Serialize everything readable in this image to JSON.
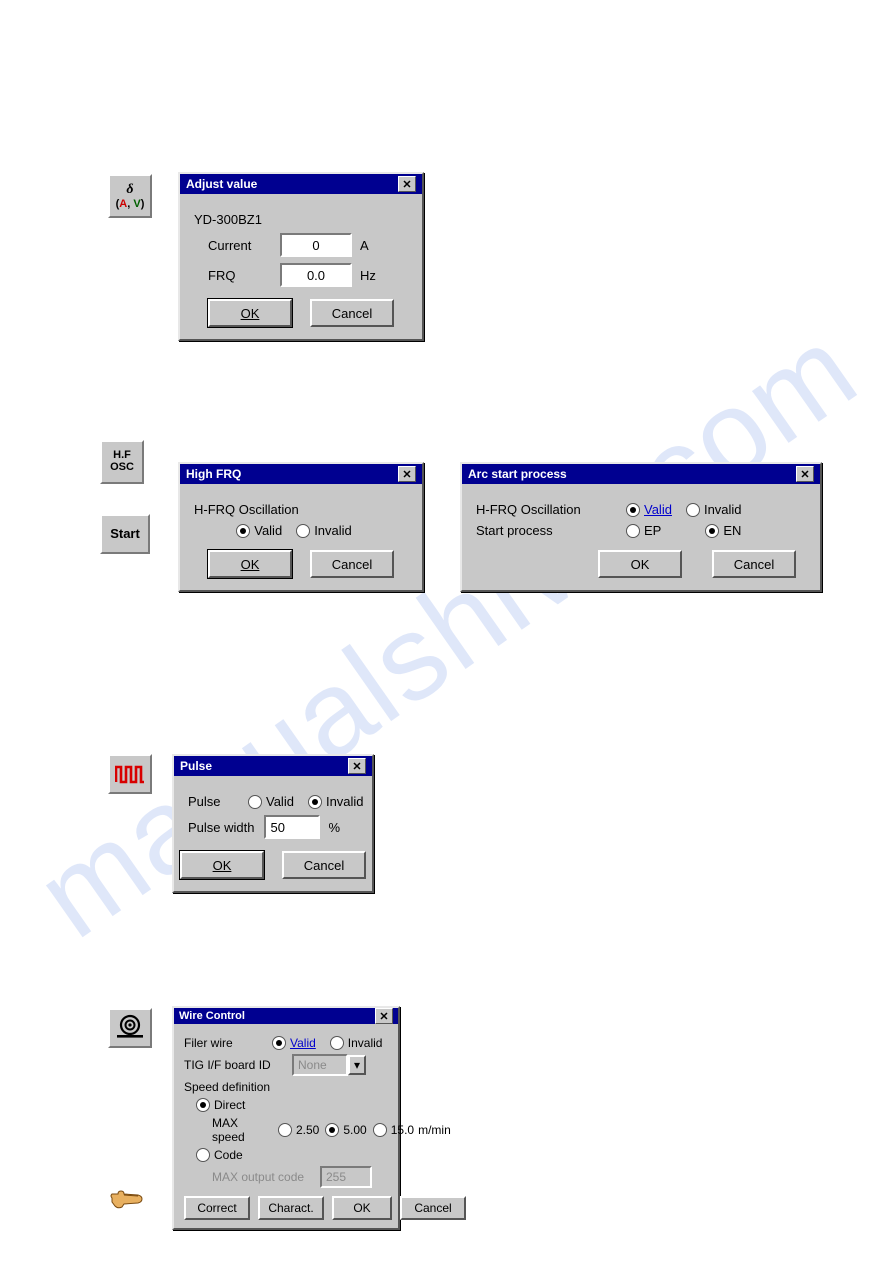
{
  "watermark": "manualshive.com",
  "adjust": {
    "title": "Adjust value",
    "device": "YD-300BZ1",
    "current_label": "Current",
    "current_value": "0",
    "current_unit": "A",
    "frq_label": "FRQ",
    "frq_value": "0.0",
    "frq_unit": "Hz",
    "ok": "OK",
    "cancel": "Cancel"
  },
  "highfrq": {
    "title": "High FRQ",
    "heading": "H-FRQ Oscillation",
    "valid": "Valid",
    "invalid": "Invalid",
    "ok": "OK",
    "cancel": "Cancel"
  },
  "arcstart": {
    "title": "Arc start process",
    "row1_label": "H-FRQ Oscillation",
    "valid": "Valid",
    "invalid": "Invalid",
    "row2_label": "Start process",
    "ep": "EP",
    "en": "EN",
    "ok": "OK",
    "cancel": "Cancel"
  },
  "pulse": {
    "title": "Pulse",
    "row1_label": "Pulse",
    "valid": "Valid",
    "invalid": "Invalid",
    "width_label": "Pulse width",
    "width_value": "50",
    "width_unit": "%",
    "ok": "OK",
    "cancel": "Cancel"
  },
  "wire": {
    "title": "Wire Control",
    "filer_label": "Filer wire",
    "valid": "Valid",
    "invalid": "Invalid",
    "board_label": "TIG I/F board ID",
    "board_value": "None",
    "speed_heading": "Speed definition",
    "direct": "Direct",
    "max_speed_label": "MAX speed",
    "s1": "2.50",
    "s2": "5.00",
    "s3": "15.0",
    "speed_unit": "m/min",
    "code": "Code",
    "max_output_label": "MAX output code",
    "max_output_value": "255",
    "correct": "Correct",
    "charact": "Charact.",
    "ok": "OK",
    "cancel": "Cancel"
  },
  "launchers": {
    "hf_line1": "H.F",
    "hf_line2": "OSC",
    "start": "Start"
  }
}
